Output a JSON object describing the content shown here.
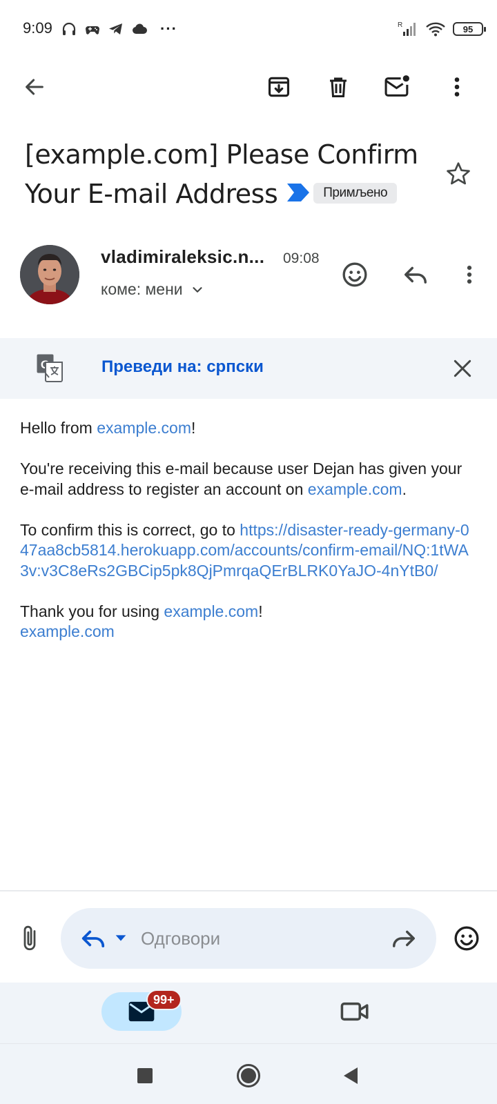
{
  "status_bar": {
    "time": "9:09",
    "battery": "95",
    "network_label": "R",
    "more_indicator": "···"
  },
  "toolbar": {
    "back_icon": "back-arrow-icon",
    "archive_icon": "archive-icon",
    "delete_icon": "trash-icon",
    "mark_unread_icon": "mark-unread-icon",
    "more_icon": "more-vert-icon"
  },
  "email": {
    "subject": "[example.com] Please Confirm Your E-mail Address",
    "label": "Примљено",
    "sender": "vladimiraleksic.n...",
    "time": "09:08",
    "recipient": "коме: мени",
    "translate_link": "Преведи на: српски",
    "body": {
      "greeting_prefix": "Hello from ",
      "greeting_link": "example.com",
      "greeting_suffix": "!",
      "p2_text": "You're receiving this e-mail because user Dejan has given your e-mail address to register an account on ",
      "p2_link": "example.com",
      "p2_suffix": ".",
      "p3_text": "To confirm this is correct, go to ",
      "p3_link": "https://disaster-ready-germany-047aa8cb5814.herokuapp.com/accounts/confirm-email/NQ:1tWA3v:v3C8eRs2GBCip5pk8QjPmrqaQErBLRK0YaJO-4nYtB0/",
      "p4_text": "Thank you for using ",
      "p4_link": "example.com",
      "p4_suffix": "!",
      "signature_link": "example.com"
    }
  },
  "reply_bar": {
    "placeholder": "Одговори"
  },
  "bottom_nav": {
    "mail_badge": "99+"
  },
  "colors": {
    "link": "#3c7ed0",
    "translate_link": "#0b57d0",
    "label_chip_bg": "#e9eaec",
    "importance_marker": "#1a73e8",
    "badge": "#b3261e",
    "active_tab": "#c2e7ff"
  }
}
